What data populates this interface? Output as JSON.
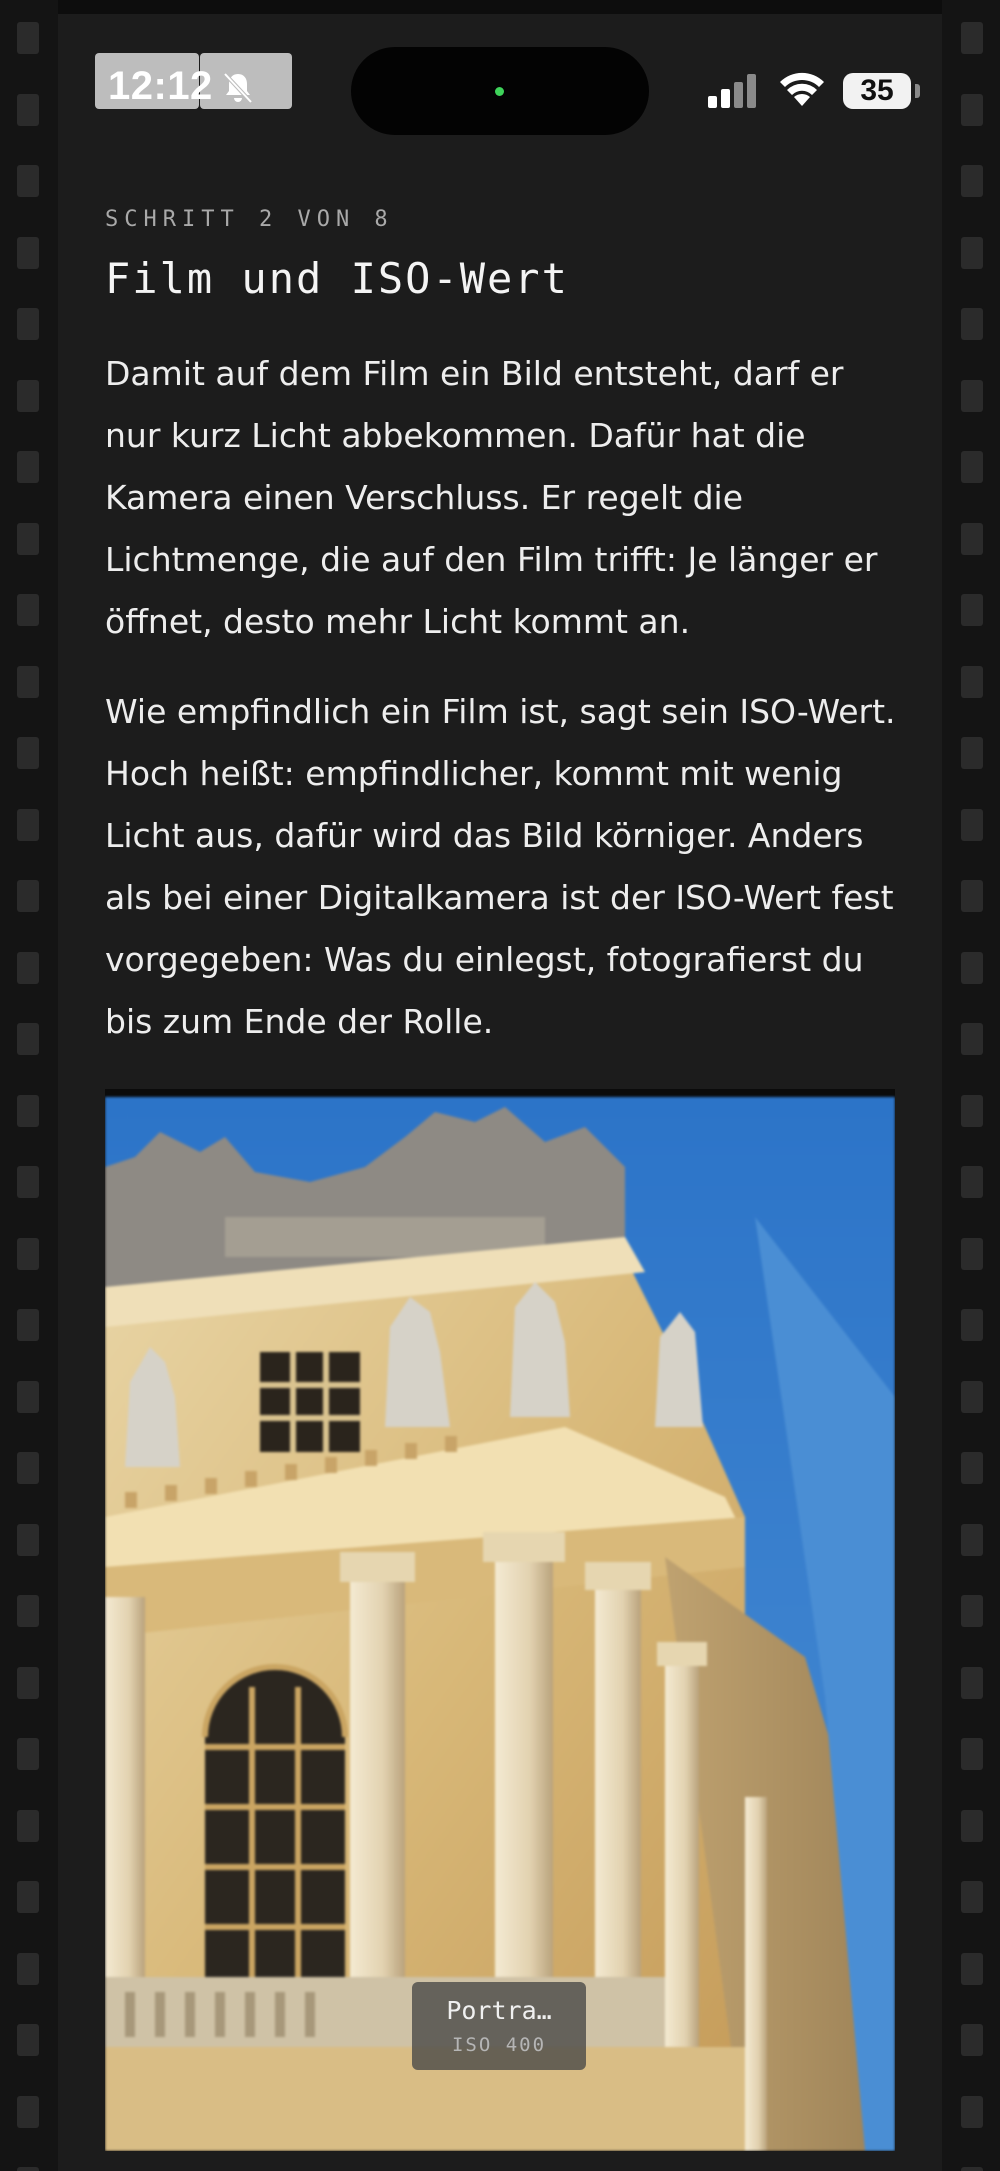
{
  "status_bar": {
    "time": "12:12",
    "battery_level": "35",
    "bell_icon": "bell-slash-icon",
    "signal_icon": "cellular-signal-icon",
    "wifi_icon": "wifi-icon"
  },
  "step": {
    "label": "SCHRITT 2 VON 8",
    "title": "Film und ISO-Wert"
  },
  "body": {
    "paragraph_1": "Damit auf dem Film ein Bild entsteht, darf er nur kurz Licht abbekommen. Dafür hat die Kamera einen Verschluss. Er regelt die Lichtmenge, die auf den Film trifft: Je länger er öffnet, desto mehr Licht kommt an.",
    "paragraph_2": "Wie empfindlich ein Film ist, sagt sein ISO-Wert. Hoch heißt: empfindlicher, kommt mit wenig Licht aus, dafür wird das Bild körniger. Anders als bei einer Digitalkamera ist der ISO-Wert fest vorgegeben: Was du einlegst, fotografierst du bis zum Ende der Rolle."
  },
  "photo": {
    "caption_name": "Portra…",
    "caption_iso": "ISO 400"
  },
  "colors": {
    "background": "#161616",
    "panel": "#1c1c1c",
    "sprocket": "#2b2b2b",
    "text": "#ededed",
    "muted": "#a9a9a9",
    "island_dot": "#3ed35a"
  }
}
